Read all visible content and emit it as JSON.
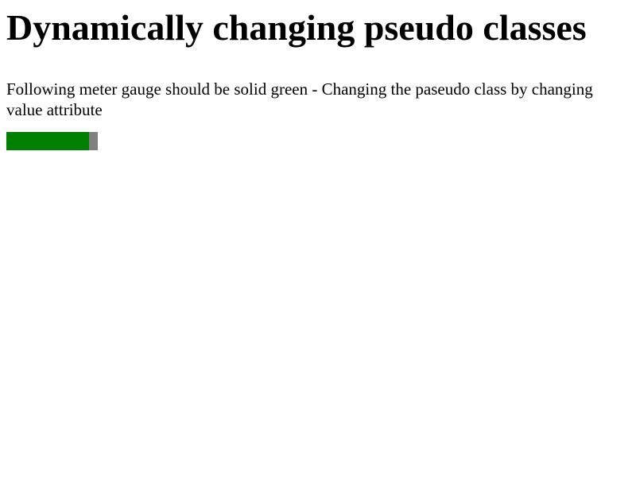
{
  "page": {
    "title": "Dynamically changing pseudo classes",
    "description": "Following meter gauge should be solid green - Changing the paseudo class by changing value attribute"
  },
  "meter": {
    "value_fraction": 0.9,
    "fill_color": "#008000",
    "track_color": "#808080"
  }
}
